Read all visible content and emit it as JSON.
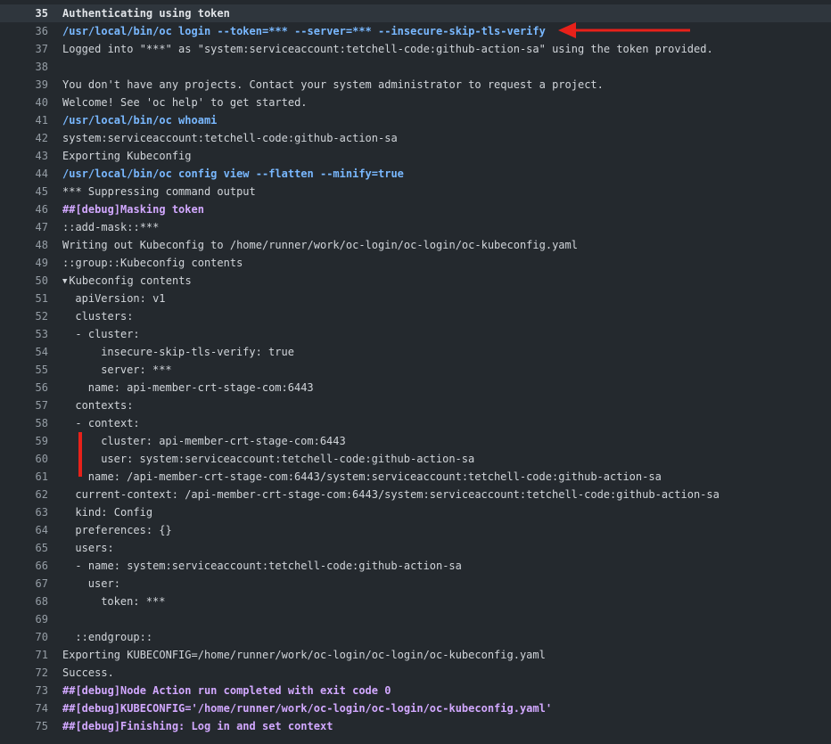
{
  "log": {
    "lines": [
      {
        "n": "35",
        "text": "Authenticating using token",
        "style": "bold",
        "indent": 0,
        "highlight": true
      },
      {
        "n": "36",
        "text": "/usr/local/bin/oc login --token=*** --server=*** --insecure-skip-tls-verify",
        "style": "cmd",
        "indent": 0
      },
      {
        "n": "37",
        "text": "Logged into \"***\" as \"system:serviceaccount:tetchell-code:github-action-sa\" using the token provided.",
        "style": "plain",
        "indent": 0
      },
      {
        "n": "38",
        "text": "",
        "style": "plain",
        "indent": 0
      },
      {
        "n": "39",
        "text": "You don't have any projects. Contact your system administrator to request a project.",
        "style": "plain",
        "indent": 0
      },
      {
        "n": "40",
        "text": "Welcome! See 'oc help' to get started.",
        "style": "plain",
        "indent": 0
      },
      {
        "n": "41",
        "text": "/usr/local/bin/oc whoami",
        "style": "cmd",
        "indent": 0
      },
      {
        "n": "42",
        "text": "system:serviceaccount:tetchell-code:github-action-sa",
        "style": "plain",
        "indent": 0
      },
      {
        "n": "43",
        "text": "Exporting Kubeconfig",
        "style": "plain",
        "indent": 0
      },
      {
        "n": "44",
        "text": "/usr/local/bin/oc config view --flatten --minify=true",
        "style": "cmd",
        "indent": 0
      },
      {
        "n": "45",
        "text": "*** Suppressing command output",
        "style": "plain",
        "indent": 0
      },
      {
        "n": "46",
        "text": "##[debug]Masking token",
        "style": "debug",
        "indent": 0
      },
      {
        "n": "47",
        "text": "::add-mask::***",
        "style": "plain",
        "indent": 0
      },
      {
        "n": "48",
        "text": "Writing out Kubeconfig to /home/runner/work/oc-login/oc-login/oc-kubeconfig.yaml",
        "style": "plain",
        "indent": 0
      },
      {
        "n": "49",
        "text": "::group::Kubeconfig contents",
        "style": "plain",
        "indent": 0
      },
      {
        "n": "50",
        "text": "Kubeconfig contents",
        "style": "group",
        "indent": 0,
        "caret": "▼"
      },
      {
        "n": "51",
        "text": "apiVersion: v1",
        "style": "plain",
        "indent": 2
      },
      {
        "n": "52",
        "text": "clusters:",
        "style": "plain",
        "indent": 2
      },
      {
        "n": "53",
        "text": "- cluster:",
        "style": "plain",
        "indent": 2
      },
      {
        "n": "54",
        "text": "insecure-skip-tls-verify: true",
        "style": "plain",
        "indent": 6
      },
      {
        "n": "55",
        "text": "server: ***",
        "style": "plain",
        "indent": 6
      },
      {
        "n": "56",
        "text": "name: api-member-crt-stage-com:6443",
        "style": "plain",
        "indent": 4
      },
      {
        "n": "57",
        "text": "contexts:",
        "style": "plain",
        "indent": 2
      },
      {
        "n": "58",
        "text": "- context:",
        "style": "plain",
        "indent": 2
      },
      {
        "n": "59",
        "text": "cluster: api-member-crt-stage-com:6443",
        "style": "plain",
        "indent": 6
      },
      {
        "n": "60",
        "text": "user: system:serviceaccount:tetchell-code:github-action-sa",
        "style": "plain",
        "indent": 6
      },
      {
        "n": "61",
        "text": "name: /api-member-crt-stage-com:6443/system:serviceaccount:tetchell-code:github-action-sa",
        "style": "plain",
        "indent": 4
      },
      {
        "n": "62",
        "text": "current-context: /api-member-crt-stage-com:6443/system:serviceaccount:tetchell-code:github-action-sa",
        "style": "plain",
        "indent": 2
      },
      {
        "n": "63",
        "text": "kind: Config",
        "style": "plain",
        "indent": 2
      },
      {
        "n": "64",
        "text": "preferences: {}",
        "style": "plain",
        "indent": 2
      },
      {
        "n": "65",
        "text": "users:",
        "style": "plain",
        "indent": 2
      },
      {
        "n": "66",
        "text": "- name: system:serviceaccount:tetchell-code:github-action-sa",
        "style": "plain",
        "indent": 2
      },
      {
        "n": "67",
        "text": "user:",
        "style": "plain",
        "indent": 4
      },
      {
        "n": "68",
        "text": "token: ***",
        "style": "plain",
        "indent": 6
      },
      {
        "n": "69",
        "text": "",
        "style": "plain",
        "indent": 0
      },
      {
        "n": "70",
        "text": "::endgroup::",
        "style": "plain",
        "indent": 2
      },
      {
        "n": "71",
        "text": "Exporting KUBECONFIG=/home/runner/work/oc-login/oc-login/oc-kubeconfig.yaml",
        "style": "plain",
        "indent": 0
      },
      {
        "n": "72",
        "text": "Success.",
        "style": "plain",
        "indent": 0
      },
      {
        "n": "73",
        "text": "##[debug]Node Action run completed with exit code 0",
        "style": "debug",
        "indent": 0
      },
      {
        "n": "74",
        "text": "##[debug]KUBECONFIG='/home/runner/work/oc-login/oc-login/oc-kubeconfig.yaml'",
        "style": "debug",
        "indent": 0
      },
      {
        "n": "75",
        "text": "##[debug]Finishing: Log in and set context",
        "style": "debug",
        "indent": 0
      }
    ]
  },
  "colors": {
    "background": "#24292e",
    "command": "#79b8ff",
    "debug": "#d2a8ff",
    "annotation": "#e8211a"
  }
}
